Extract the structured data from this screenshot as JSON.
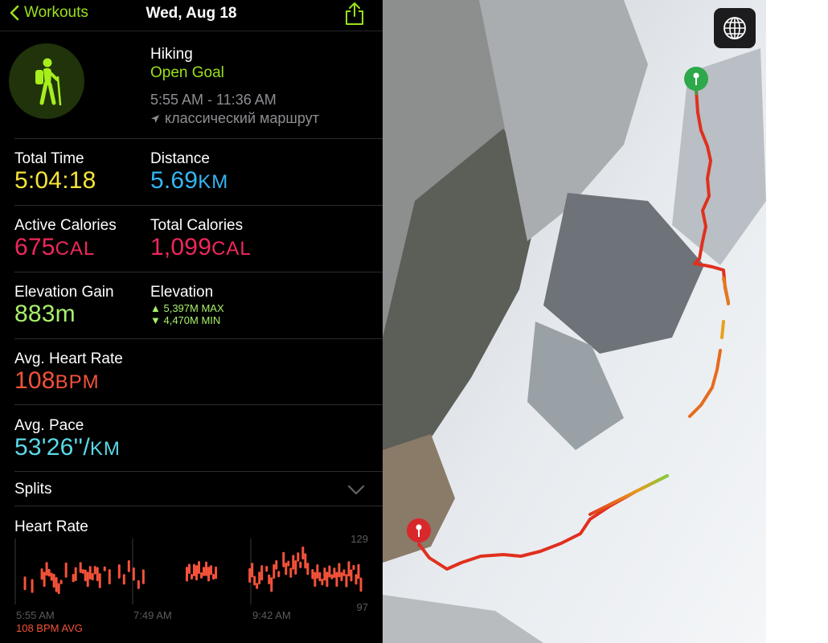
{
  "nav": {
    "back_label": "Workouts",
    "title": "Wed, Aug 18"
  },
  "workout": {
    "type": "Hiking",
    "goal": "Open Goal",
    "time_range": "5:55 AM - 11:36 AM",
    "route": "классический маршрут"
  },
  "stats": {
    "total_time": {
      "label": "Total Time",
      "value": "5:04:18"
    },
    "distance": {
      "label": "Distance",
      "value": "5.69",
      "unit": "KM"
    },
    "active_calories": {
      "label": "Active Calories",
      "value": "675",
      "unit": "CAL"
    },
    "total_calories": {
      "label": "Total Calories",
      "value": "1,099",
      "unit": "CAL"
    },
    "elevation_gain": {
      "label": "Elevation Gain",
      "value": "883m"
    },
    "elevation": {
      "label": "Elevation",
      "max": "▲ 5,397M MAX",
      "min": "▼ 4,470M MIN"
    },
    "avg_heart_rate": {
      "label": "Avg. Heart Rate",
      "value": "108",
      "unit": "BPM"
    },
    "avg_pace": {
      "label": "Avg. Pace",
      "value": "53'26''/",
      "unit": "KM"
    }
  },
  "splits": {
    "label": "Splits"
  },
  "heart_rate": {
    "title": "Heart Rate",
    "avg_label": "108 BPM AVG"
  },
  "colors": {
    "accent_green": "#9be01a",
    "time_yellow": "#f6e33a",
    "distance_blue": "#35b6f4",
    "calories_pink": "#f0275b",
    "elevation_green": "#a7f06a",
    "heart_red": "#f5523a",
    "pace_cyan": "#5ad9e8"
  },
  "icons": [
    "chevron-left-icon",
    "share-icon",
    "hiker-icon",
    "location-arrow-icon",
    "chevron-down-icon",
    "globe-icon",
    "start-pin-icon",
    "end-pin-icon"
  ],
  "chart_data": {
    "type": "scatter",
    "title": "Heart Rate",
    "x_ticks": [
      "5:55 AM",
      "7:49 AM",
      "9:42 AM"
    ],
    "y_ticks": [
      129,
      97
    ],
    "ylim": [
      85,
      135
    ],
    "grid": false,
    "series": [
      {
        "values": [
          [
            0.3,
            101
          ],
          [
            0.6,
            99
          ],
          [
            1.0,
            108
          ],
          [
            1.1,
            104
          ],
          [
            1.2,
            112
          ],
          [
            1.3,
            109
          ],
          [
            1.4,
            106
          ],
          [
            1.5,
            103
          ],
          [
            1.6,
            100
          ],
          [
            1.7,
            97
          ],
          [
            1.8,
            102
          ],
          [
            2.0,
            111
          ],
          [
            2.3,
            105
          ],
          [
            2.4,
            108
          ],
          [
            2.6,
            113
          ],
          [
            2.7,
            110
          ],
          [
            2.8,
            107
          ],
          [
            2.9,
            104
          ],
          [
            3.0,
            109
          ],
          [
            3.1,
            106
          ],
          [
            3.2,
            111
          ],
          [
            3.3,
            108
          ],
          [
            3.4,
            103
          ],
          [
            3.6,
            112
          ],
          [
            3.8,
            106
          ],
          [
            4.2,
            110
          ],
          [
            4.4,
            104
          ],
          [
            4.6,
            114
          ],
          [
            4.8,
            108
          ],
          [
            5.0,
            100
          ],
          [
            5.2,
            106
          ],
          [
            7.0,
            108
          ],
          [
            7.1,
            112
          ],
          [
            7.2,
            106
          ],
          [
            7.3,
            111
          ],
          [
            7.4,
            109
          ],
          [
            7.5,
            113
          ],
          [
            7.6,
            107
          ],
          [
            7.7,
            110
          ],
          [
            7.8,
            112
          ],
          [
            7.9,
            108
          ],
          [
            8.0,
            111
          ],
          [
            8.1,
            106
          ],
          [
            8.2,
            109
          ],
          [
            9.6,
            107
          ],
          [
            9.7,
            111
          ],
          [
            9.8,
            103
          ],
          [
            9.9,
            99
          ],
          [
            10.0,
            105
          ],
          [
            10.1,
            109
          ],
          [
            10.3,
            112
          ],
          [
            10.4,
            104
          ],
          [
            10.5,
            100
          ],
          [
            10.6,
            110
          ],
          [
            10.7,
            115
          ],
          [
            10.8,
            108
          ],
          [
            11.0,
            119
          ],
          [
            11.1,
            112
          ],
          [
            11.2,
            116
          ],
          [
            11.3,
            109
          ],
          [
            11.4,
            117
          ],
          [
            11.5,
            113
          ],
          [
            11.6,
            121
          ],
          [
            11.7,
            115
          ],
          [
            11.8,
            124
          ],
          [
            11.9,
            118
          ],
          [
            12.0,
            112
          ],
          [
            12.2,
            108
          ],
          [
            12.3,
            104
          ],
          [
            12.4,
            110
          ],
          [
            12.5,
            106
          ],
          [
            12.6,
            102
          ],
          [
            12.7,
            108
          ],
          [
            12.8,
            104
          ],
          [
            12.9,
            110
          ],
          [
            13.0,
            106
          ],
          [
            13.1,
            109
          ],
          [
            13.2,
            104
          ],
          [
            13.3,
            111
          ],
          [
            13.4,
            106
          ],
          [
            13.5,
            109
          ],
          [
            13.6,
            103
          ],
          [
            13.7,
            112
          ],
          [
            13.8,
            107
          ],
          [
            13.9,
            113
          ],
          [
            14.0,
            104
          ],
          [
            14.1,
            110
          ],
          [
            14.2,
            100
          ]
        ]
      }
    ]
  }
}
